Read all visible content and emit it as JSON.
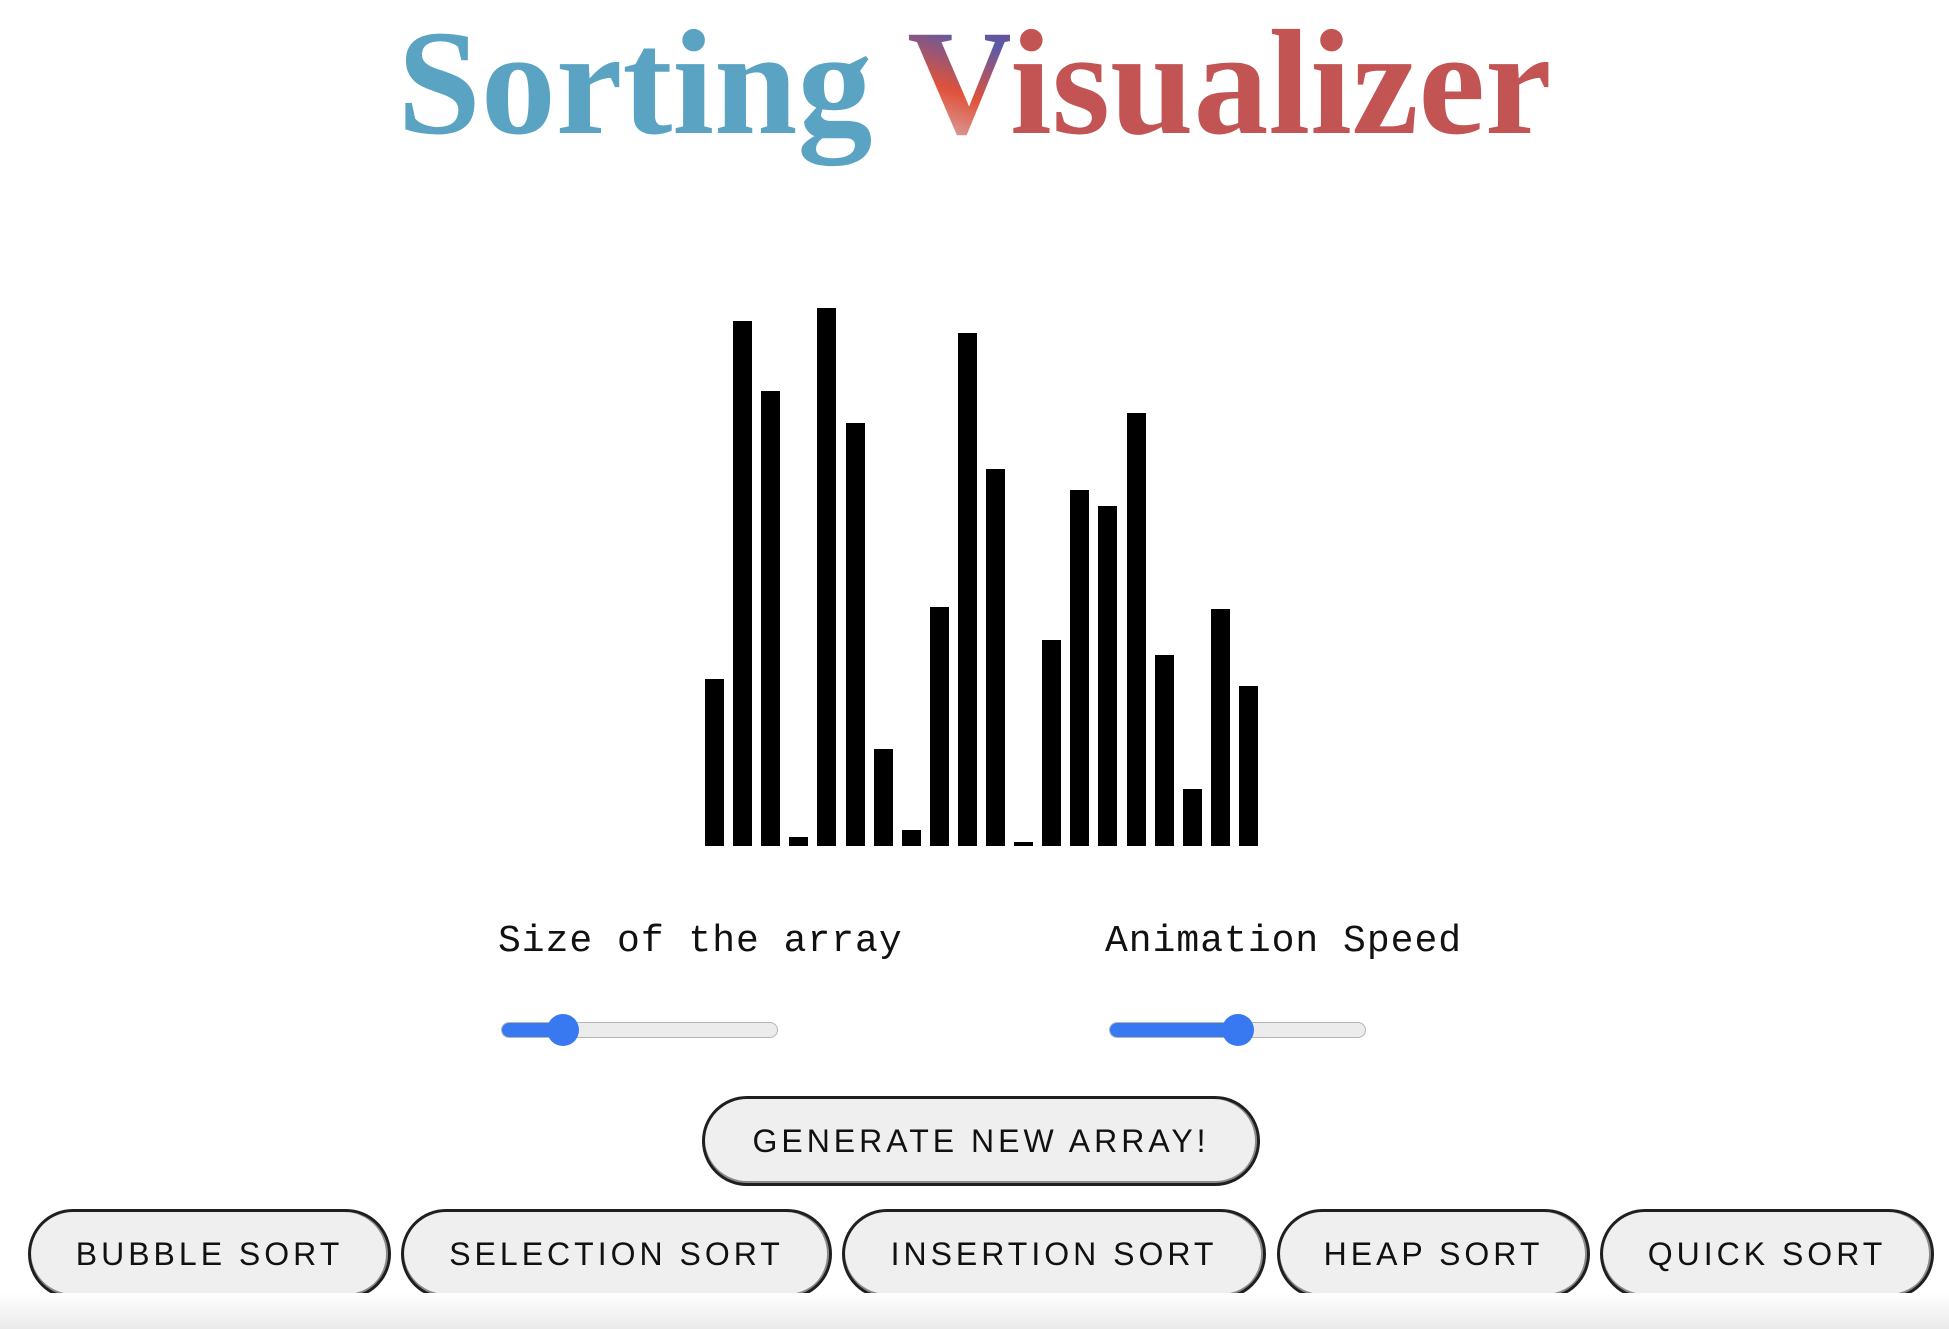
{
  "header": {
    "title_part1": "Sorting",
    "title_part2_first": "V",
    "title_part2_rest": "isualizer"
  },
  "chart_data": {
    "type": "bar",
    "values": [
      167,
      525,
      455,
      9,
      538,
      423,
      97,
      16,
      239,
      513,
      377,
      4,
      206,
      356,
      340,
      433,
      191,
      57,
      237,
      160
    ],
    "ylim": [
      0,
      540
    ],
    "bar_color": "#000000"
  },
  "controls": {
    "size_label": "Size of the array",
    "speed_label": "Animation Speed",
    "size_value": 0.22,
    "speed_value": 0.5,
    "accent_color": "#3878f0"
  },
  "buttons": {
    "generate": "GENERATE NEW ARRAY!",
    "bubble": "BUBBLE SORT",
    "selection": "SELECTION SORT",
    "insertion": "INSERTION SORT",
    "heap": "HEAP SORT",
    "quick": "QUICK SORT"
  }
}
